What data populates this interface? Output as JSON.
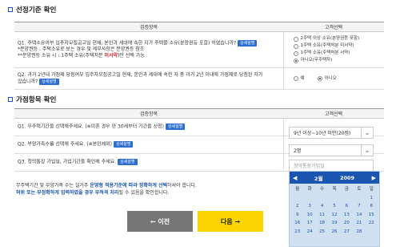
{
  "section1": {
    "title": "선정기준 확인",
    "col_item": "검증항목",
    "col_select": "고객선택",
    "q1": {
      "line1": "Q1. 주택소유여부 입주자모집공고일 현재, 본인과 세대에 속한 자가 주택을 소유(분양권등 포함) 하였습니까?",
      "line2": "*분양권등 : 주택소유로 보는 경우 및 세부사항은 분양권등 참조",
      "line3_a": "**분양권등 소유 시 : 1주택 소유(주택처분 ",
      "line3_b": "미서약",
      "line3_c": ")만 선택 가능",
      "badge": "상세설명",
      "options": [
        "2주택 이상 소유(분양권등 포함)",
        "1주택 소유(주택처분 미서약)",
        "1주택 소유(주택처분 서약)",
        "아니오(무주택자)"
      ],
      "selected": 3
    },
    "q2": {
      "line1": "Q2. 과거 2년내 가점제 당첨여부 입주자모집공고일 현재, 본인과 세대에 속한 자 중 과거 2년 이내에 가점제로 당첨된 자가",
      "line2": "있습니까?",
      "badge": "상세설명",
      "options": [
        "예",
        "아니오"
      ],
      "selected": 1
    }
  },
  "section2": {
    "title": "가점항목 확인",
    "col_item": "검증항목",
    "col_select": "고객선택",
    "q1": {
      "text": "Q1. 무주택기간을 선택해주세요. (※미혼 경우 만 30세부터 기간을 산정)",
      "badge": "상세설명",
      "value": "9년 이상~10년 미만(20점)"
    },
    "q2": {
      "text": "Q2. 부양가족수를 선택해 주세요. (※본인제외)",
      "badge": "상세설명",
      "value": "2명"
    },
    "q3": {
      "text": "Q3. 청약통장 가입일, 가입기간을 확인해 주세요.",
      "badge": "상세설명",
      "placeholder": "청약통장가입일"
    }
  },
  "notice": {
    "line1_a": "무주택기간 및 부양가족 수는 실거주 ",
    "line1_b": "운영형 적용기준에 따라 정확하게 선택",
    "line1_c": "하셔야 합니다.",
    "line2_a": "허위 또는 부정확하게 입력하였을 경우 부적격 처리",
    "line2_b": "될 수 있음을 확인합니다."
  },
  "buttons": {
    "prev": "← 이전",
    "next": "다음 →"
  },
  "calendar": {
    "prev": "◀",
    "next": "▶",
    "month": "2월",
    "year": "2009",
    "weekdays": [
      "월",
      "화",
      "수",
      "목",
      "금",
      "토",
      "일"
    ],
    "days": [
      "",
      "",
      "",
      "",
      "",
      "",
      "1",
      "2",
      "3",
      "4",
      "5",
      "6",
      "7",
      "8",
      "9",
      "10",
      "11",
      "12",
      "13",
      "14",
      "15",
      "16",
      "17",
      "18",
      "19",
      "20",
      "21",
      "22",
      "23",
      "24",
      "25",
      "26",
      "27",
      "28",
      ""
    ]
  },
  "colors": {
    "accent": "#1a55b0",
    "badge": "#2d6fd1",
    "next_button": "#fcd401",
    "prev_button": "#777777"
  }
}
